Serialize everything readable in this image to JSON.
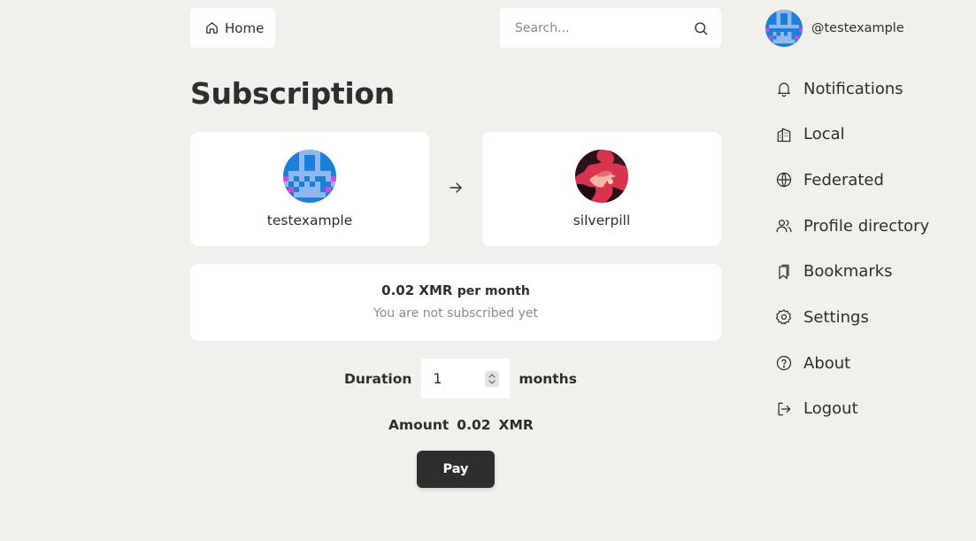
{
  "header": {
    "home_label": "Home",
    "search_placeholder": "Search..."
  },
  "page": {
    "title": "Subscription"
  },
  "sender": {
    "name": "testexample"
  },
  "recipient": {
    "name": "silverpill"
  },
  "price": {
    "amount": "0.02 XMR",
    "period": "per month",
    "status": "You are not subscribed yet"
  },
  "form": {
    "duration_label": "Duration",
    "duration_value": "1",
    "duration_unit": "months",
    "amount_label": "Amount",
    "amount_value": "0.02",
    "amount_currency": "XMR",
    "pay_label": "Pay"
  },
  "user": {
    "handle": "@testexample"
  },
  "sidebar": {
    "items": [
      {
        "label": "Notifications",
        "icon": "bell-icon"
      },
      {
        "label": "Local",
        "icon": "building-icon"
      },
      {
        "label": "Federated",
        "icon": "globe-icon"
      },
      {
        "label": "Profile directory",
        "icon": "users-icon"
      },
      {
        "label": "Bookmarks",
        "icon": "bookmark-icon"
      },
      {
        "label": "Settings",
        "icon": "gear-icon"
      },
      {
        "label": "About",
        "icon": "help-circle-icon"
      },
      {
        "label": "Logout",
        "icon": "logout-icon"
      }
    ]
  },
  "colors": {
    "background": "#f2f0ed",
    "card": "#ffffff",
    "text": "#2e2e2e",
    "muted": "#8b8b8b",
    "button": "#2e2e2e"
  }
}
